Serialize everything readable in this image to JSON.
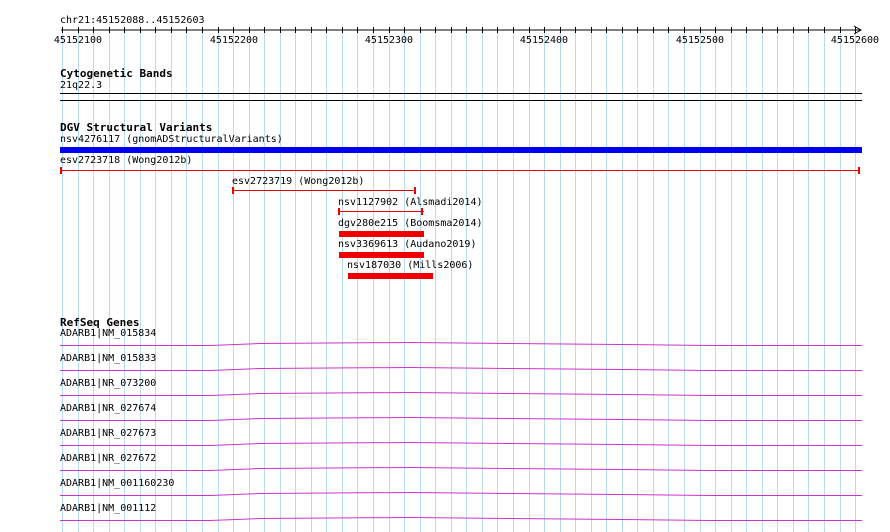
{
  "ruler": {
    "position_label": "chr21:45152088..45152603",
    "ticks": [
      "45152100",
      "45152200",
      "45152300",
      "45152400",
      "45152500",
      "45152600"
    ]
  },
  "cytoband": {
    "track_title": "Cytogenetic Bands",
    "band_label": "21q22.3"
  },
  "dgv": {
    "track_title": "DGV Structural Variants",
    "features": [
      {
        "label": "nsv4276117 (gnomADStructuralVariants)",
        "style": "thick",
        "color": "#0000ee"
      },
      {
        "label": "esv2723718 (Wong2012b)",
        "style": "thin",
        "color": "#ee0000"
      },
      {
        "label": "esv2723719 (Wong2012b)",
        "style": "thin",
        "color": "#ee0000"
      },
      {
        "label": "nsv1127902 (Alsmadi2014)",
        "style": "thin",
        "color": "#ee0000"
      },
      {
        "label": "dgv280e215 (Boomsma2014)",
        "style": "thick",
        "color": "#ee0000"
      },
      {
        "label": "nsv3369613 (Audano2019)",
        "style": "thick",
        "color": "#ee0000"
      },
      {
        "label": "nsv187030 (Mills2006)",
        "style": "thick",
        "color": "#ee0000"
      }
    ]
  },
  "refseq": {
    "track_title": "RefSeq Genes",
    "line_color": "#cc33cc",
    "genes": [
      "ADARB1|NM_015834",
      "ADARB1|NM_015833",
      "ADARB1|NR_073200",
      "ADARB1|NR_027674",
      "ADARB1|NR_027673",
      "ADARB1|NR_027672",
      "ADARB1|NM_001160230",
      "ADARB1|NM_001112"
    ]
  }
}
